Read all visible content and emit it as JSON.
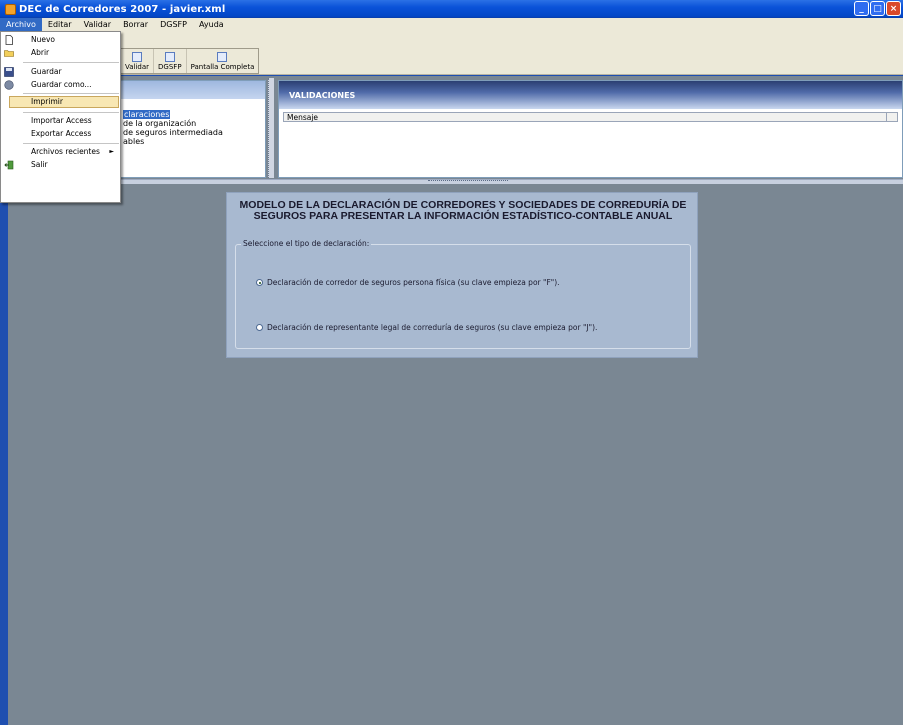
{
  "window": {
    "title": "DEC de Corredores 2007 - javier.xml",
    "controls": {
      "minimize": "_",
      "maximize": "□",
      "close": "×"
    }
  },
  "menubar": {
    "items": [
      {
        "label": "Archivo"
      },
      {
        "label": "Editar"
      },
      {
        "label": "Validar"
      },
      {
        "label": "Borrar"
      },
      {
        "label": "DGSFP"
      },
      {
        "label": "Ayuda"
      }
    ]
  },
  "toolbar": {
    "buttons": [
      {
        "label": "Validar"
      },
      {
        "label": "DGSFP"
      },
      {
        "label": "Pantalla Completa"
      }
    ]
  },
  "file_menu": {
    "items": [
      {
        "label": "Nuevo",
        "icon": "new-file-icon"
      },
      {
        "label": "Abrir",
        "icon": "open-folder-icon"
      },
      {
        "label": "Guardar",
        "icon": "save-disk-icon"
      },
      {
        "label": "Guardar como...",
        "icon": "save-as-icon"
      },
      {
        "label": "Imprimir",
        "icon": ""
      },
      {
        "label": "Importar Access",
        "icon": ""
      },
      {
        "label": "Exportar Access",
        "icon": ""
      },
      {
        "label": "Archivos recientes",
        "icon": "",
        "submenu_arrow": "►"
      },
      {
        "label": "Salir",
        "icon": "exit-icon"
      }
    ]
  },
  "tree": {
    "lines": [
      {
        "text": "claraciones",
        "selected": true
      },
      {
        "text": "de la organización",
        "selected": false
      },
      {
        "text": "de seguros intermediada",
        "selected": false
      },
      {
        "text": "ables",
        "selected": false
      }
    ]
  },
  "validations": {
    "title": "VALIDACIONES",
    "column": "Mensaje"
  },
  "declaration_form": {
    "title_line1": "MODELO DE LA DECLARACIÓN DE CORREDORES Y SOCIEDADES DE CORREDURÍA DE",
    "title_line2": "SEGUROS PARA PRESENTAR LA INFORMACIÓN ESTADÍSTICO-CONTABLE ANUAL",
    "group_label": "Seleccione el tipo de declaración:",
    "option_fisica": "Declaración de corredor de seguros persona física (su clave empieza por \"F\").",
    "option_juridica": "Declaración de representante legal de correduría de seguros (su clave empieza por \"J\").",
    "selected": "fisica"
  },
  "colors": {
    "titlebar": "#0a52d8",
    "workspace": "#7a8793",
    "form_panel": "#a8b9d0",
    "highlight": "#f8e7b3",
    "selection": "#316ac5"
  }
}
